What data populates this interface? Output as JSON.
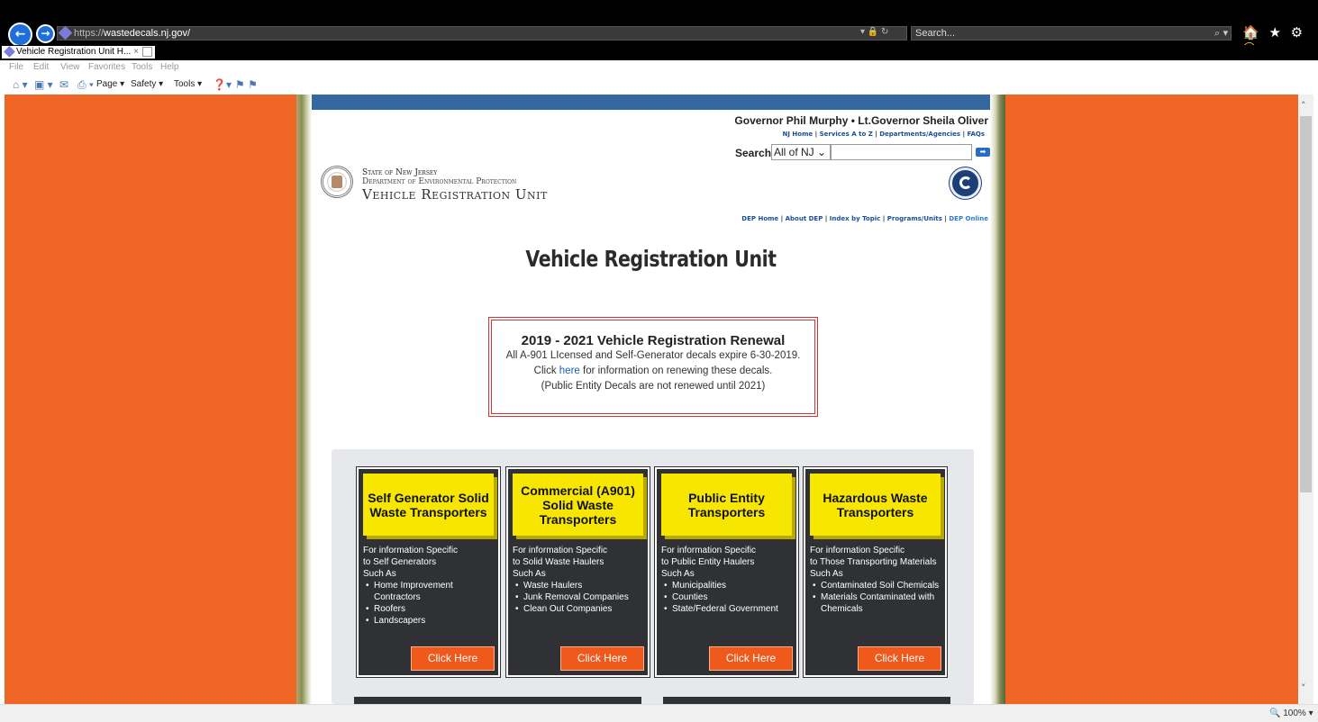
{
  "browser": {
    "url_prefix": "https://",
    "url_domain": "wastedecals.nj.gov/",
    "address_controls": "▾ 🔒 ↻",
    "search_placeholder": "Search...",
    "search_icon": "⌕ ▾",
    "right_icons": "🏠 ★ ⚙",
    "smile": "☺",
    "tab_title": "Vehicle Registration Unit H...",
    "tab_close": "×",
    "menu": [
      "File",
      "Edit",
      "View",
      "Favorites",
      "Tools",
      "Help"
    ],
    "commands": {
      "home": "⌂ ▾",
      "feeds": "▣ ▾",
      "mail": "✉",
      "print": "⎙ ▾",
      "page": "Page ▾",
      "safety": "Safety ▾",
      "tools": "Tools ▾",
      "help": "❓▾",
      "research": "⚑ ⚑"
    },
    "zoom": "🔍 100%  ▾"
  },
  "header": {
    "governor": "Governor Phil Murphy • Lt.Governor Sheila Oliver",
    "nj_links": [
      "NJ Home",
      "Services A to Z",
      "Departments/Agencies",
      "FAQs"
    ],
    "search_label": "Search",
    "search_select": "All of NJ ⌄",
    "search_go": "➡",
    "state": "State of New Jersey",
    "department": "Department of Environmental Protection",
    "unit": "Vehicle Registration Unit",
    "dep_links": [
      "DEP Home",
      "About DEP",
      "Index by Topic",
      "Programs/Units"
    ],
    "dep_online": "DEP Online",
    "sep": "|"
  },
  "main": {
    "title": "Vehicle Registration Unit",
    "renewal": {
      "title": "2019 - 2021 Vehicle Registration Renewal",
      "line1": "All A-901 LIcensed and Self-Generator decals expire 6-30-2019.",
      "line2_pre": "Click ",
      "line2_link": "here",
      "line2_post": " for information on renewing these decals.",
      "line3": "(Public Entity Decals are not renewed until 2021)"
    },
    "cards": [
      {
        "title": "Self Generator Solid Waste Transporters",
        "intro": [
          "For information Specific",
          "to Self Generators",
          "Such As"
        ],
        "items": [
          "Home Improvement Contractors",
          "Roofers",
          "Landscapers"
        ],
        "button": "Click Here"
      },
      {
        "title": "Commercial (A901) Solid Waste Transporters",
        "intro": [
          "For information Specific",
          "to Solid Waste Haulers",
          "Such As"
        ],
        "items": [
          "Waste Haulers",
          "Junk Removal Companies",
          "Clean Out Companies"
        ],
        "button": "Click Here"
      },
      {
        "title": "Public Entity Transporters",
        "intro": [
          "For information Specific",
          "to Public Entity Haulers",
          "Such As"
        ],
        "items": [
          "Municipalities",
          "Counties",
          "State/Federal Government"
        ],
        "button": "Click Here"
      },
      {
        "title": "Hazardous Waste Transporters",
        "intro": [
          "For information Specific",
          "to Those Transporting Materials",
          "Such As"
        ],
        "items": [
          "Contaminated Soil Chemicals",
          "Materials Contaminated with Chemicals"
        ],
        "button": "Click Here"
      }
    ]
  },
  "colors": {
    "page_bg": "#ef6526",
    "band": "#35689f",
    "card_bg": "#2f3135",
    "card_title_bg": "#f7e600",
    "button_bg": "#ef5a1c"
  }
}
